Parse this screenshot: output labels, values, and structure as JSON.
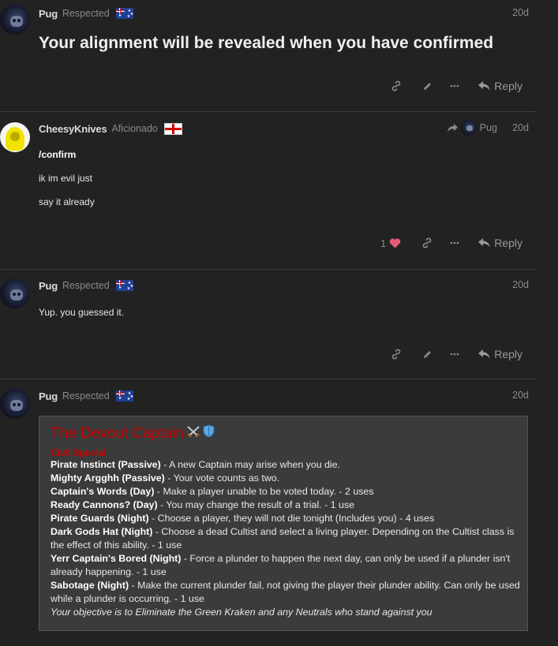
{
  "posts": [
    {
      "username": "Pug",
      "user_title": "Respected",
      "flag": "australia-flag",
      "date": "20d",
      "body": [
        "Your alignment will be revealed when you have confirmed"
      ],
      "actions": {
        "reply_label": "Reply"
      }
    },
    {
      "username": "CheesyKnives",
      "user_title": "Aficionado",
      "flag": "england-flag",
      "date": "20d",
      "reply_to": "Pug",
      "body": [
        "/confirm",
        "ik im evil just",
        "say it already"
      ],
      "actions": {
        "like_count": "1",
        "reply_label": "Reply"
      }
    },
    {
      "username": "Pug",
      "user_title": "Respected",
      "flag": "australia-flag",
      "date": "20d",
      "body": [
        "Yup. you guessed it."
      ],
      "actions": {
        "reply_label": "Reply"
      }
    },
    {
      "username": "Pug",
      "user_title": "Respected",
      "flag": "australia-flag",
      "date": "20d",
      "role_card": {
        "title": "The Devout Captain",
        "title_icons": [
          "crossed-swords-icon",
          "shield-icon"
        ],
        "faction": "Civil Special",
        "abilities": [
          {
            "name": "Pirate Instinct (Passive)",
            "desc": " - A new Captain may arise when you die."
          },
          {
            "name": "Mighty Argghh (Passive)",
            "desc": " - Your vote counts as two."
          },
          {
            "name": "Captain's Words (Day)",
            "desc": " - Make a player unable to be voted today. - 2 uses"
          },
          {
            "name": "Ready Cannons? (Day)",
            "desc": " - You may change the result of a trial. - 1 use"
          },
          {
            "name": "Pirate Guards (Night)",
            "desc": " - Choose a player, they will not die tonight (Includes you) - 4 uses"
          },
          {
            "name": "Dark Gods Hat (Night)",
            "desc": " - Choose a dead Cultist and select a living player. Depending on the Cultist class is the effect of this ability. - 1 use"
          },
          {
            "name": "Yerr Captain's Bored (Night)",
            "desc": " - Force a plunder to happen the next day, can only be used if a plunder isn't already happening. - 1 use"
          },
          {
            "name": "Sabotage (Night)",
            "desc": " - Make the current plunder fail, not giving the player their plunder ability. Can only be used while a plunder is occurring. - 1 use"
          }
        ],
        "objective": "Your objective is to Eliminate the Green Kraken and any Neutrals who stand against you"
      }
    }
  ],
  "colors": {
    "background": "#222222",
    "role_title": "#cc0000",
    "like_heart": "#e45b73"
  }
}
